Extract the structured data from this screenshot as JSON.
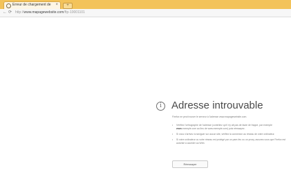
{
  "tab": {
    "title": "Erreur de chargement de la...",
    "close": "×",
    "new_tab": "+"
  },
  "toolbar": {
    "back": "←",
    "reload": "⟳",
    "url_prefix": "http://",
    "url_host": "www.mapagewebsite.com",
    "url_path": "/ftp-10001101"
  },
  "error": {
    "icon": "i",
    "title": "Adresse introuvable",
    "description": "Firefox ne peut trouver le serveur à l'adresse www.mapagewebsite.com.",
    "suggestions": [
      {
        "before": "Vérifiez l'orthographe de l'adresse (contrôlez qu'il n'y ait pas de faute de frappe, par exemple ",
        "bold": "www",
        "after": ".exemple.com au lieu de www.exemple.com) puis réessayez."
      },
      {
        "before": "Si vous n'arrivez à naviguer sur aucun site, vérifiez la connexion au réseau de votre ordinateur.",
        "bold": "",
        "after": ""
      },
      {
        "before": "Si votre ordinateur ou votre réseau est protégé par un pare-feu ou un proxy, assurez-vous que Firefox est autorisé à accéder au Web.",
        "bold": "",
        "after": ""
      }
    ],
    "button": "Réessayer"
  }
}
